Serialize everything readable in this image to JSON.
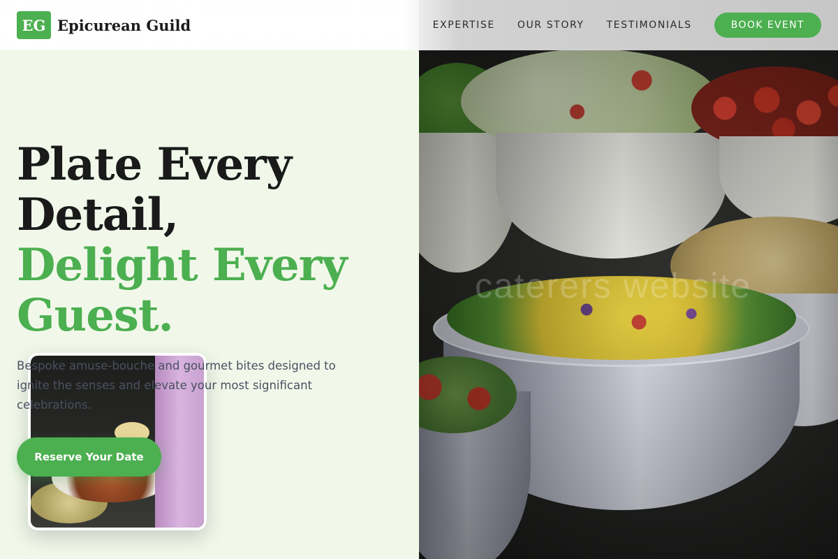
{
  "brand": {
    "mark": "EG",
    "name": "Epicurean Guild"
  },
  "nav": {
    "links": [
      "EXPERTISE",
      "OUR STORY",
      "TESTIMONIALS"
    ],
    "cta_label": "BOOK EVENT"
  },
  "hero": {
    "title_line1": "Plate Every",
    "title_line2": "Detail,",
    "title_accent_line1": "Delight Every",
    "title_accent_line2": "Guest.",
    "description": "Bespoke amuse-bouche and gourmet bites designed to ignite the senses and elevate your most significant celebrations.",
    "cta_label": "Reserve Your Date"
  },
  "watermark": "caterers website",
  "colors": {
    "accent": "#4caf50",
    "page_background": "#f1f8ea",
    "heading": "#1a1a1a",
    "body_text": "#4a5060"
  }
}
